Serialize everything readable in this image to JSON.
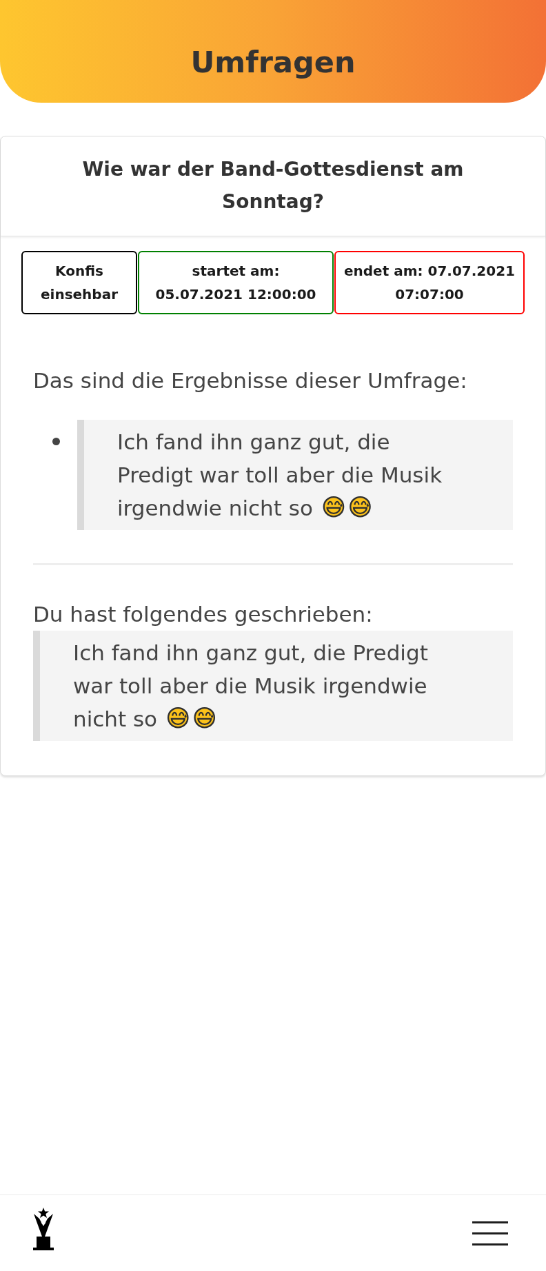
{
  "header": {
    "title": "Umfragen"
  },
  "poll": {
    "question": "Wie war der Band-Gottesdienst am Sonntag?",
    "tags": [
      {
        "label": "Konfis einsehbar",
        "color": "#000000"
      },
      {
        "label": "startet am: 05.07.2021 12:00:00",
        "color": "#008000"
      },
      {
        "label": "endet am: 07.07.2021 07:07:00",
        "color": "#ff0000"
      }
    ],
    "results_heading": "Das sind die Ergebnisse dieser Umfrage:",
    "results": [
      {
        "text": "Ich fand ihn ganz gut, die Predigt war toll aber die Musik irgendwie nicht so 😅😅"
      }
    ],
    "own_answer_heading": "Du hast folgendes geschrieben:",
    "own_answer": {
      "text": "Ich fand ihn ganz gut, die Predigt war toll aber die Musik irgendwie nicht so 😅😅"
    }
  },
  "bottom_nav": {
    "items": [
      {
        "kind": "trophy"
      },
      {
        "kind": "menu"
      }
    ]
  }
}
